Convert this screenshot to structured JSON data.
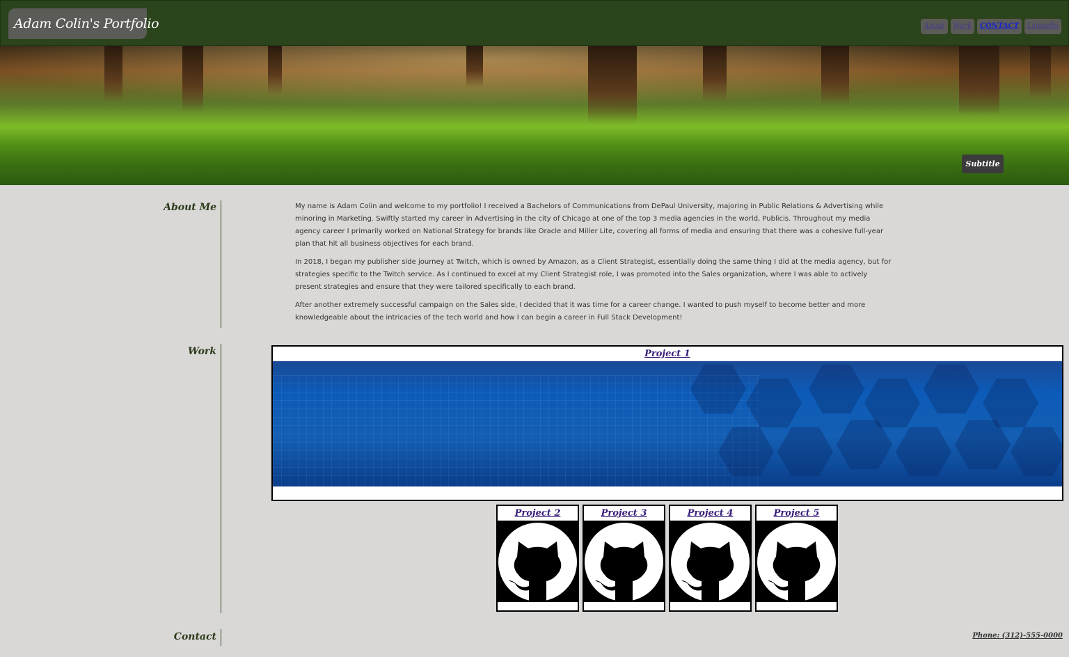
{
  "header": {
    "title": "Adam Colin's Portfolio",
    "nav": [
      {
        "label": "About",
        "active": false
      },
      {
        "label": "Work",
        "active": false
      },
      {
        "label": "CONTACT",
        "active": true
      },
      {
        "label": "LinkedIn",
        "active": false
      }
    ]
  },
  "hero": {
    "subtitle": "Subtitle"
  },
  "about": {
    "heading": "About Me",
    "paragraphs": [
      "My name is Adam Colin and welcome to my portfolio! I received a Bachelors of Communications from DePaul University, majoring in Public Relations & Advertising while minoring in Marketing. Swiftly started my career in Advertising in the city of Chicago at one of the top 3 media agencies in the world, Publicis. Throughout my media agency career I primarily worked on National Strategy for brands like Oracle and Miller Lite, covering all forms of media and ensuring that there was a cohesive full-year plan that hit all business objectives for each brand.",
      "In 2018, I began my publisher side journey at Twitch, which is owned by Amazon, as a Client Strategist, essentially doing the same thing I did at the media agency, but for strategies specific to the Twitch service. As I continued to excel at my Client Strategist role, I was promoted into the Sales organization, where I was able to actively present strategies and ensure that they were tailored specifically to each brand.",
      "After another extremely successful campaign on the Sales side, I decided that it was time for a career change. I wanted to push myself to become better and more knowledgeable about the intricacies of the tech world and how I can begin a career in Full Stack Development!"
    ]
  },
  "work": {
    "heading": "Work",
    "projects": [
      {
        "label": "Project 1",
        "image": "blue-tech-banner"
      },
      {
        "label": "Project 2",
        "image": "github-octocat-icon"
      },
      {
        "label": "Project 3",
        "image": "github-octocat-icon"
      },
      {
        "label": "Project 4",
        "image": "github-octocat-icon"
      },
      {
        "label": "Project 5",
        "image": "github-octocat-icon"
      }
    ]
  },
  "contact": {
    "heading": "Contact",
    "phone": "Phone: (312)-555-0000"
  },
  "colors": {
    "header_bg": "#2b441c",
    "page_bg": "#d9d8d6",
    "link": "#3a1e7a",
    "accent_gray": "#5b5c58"
  }
}
